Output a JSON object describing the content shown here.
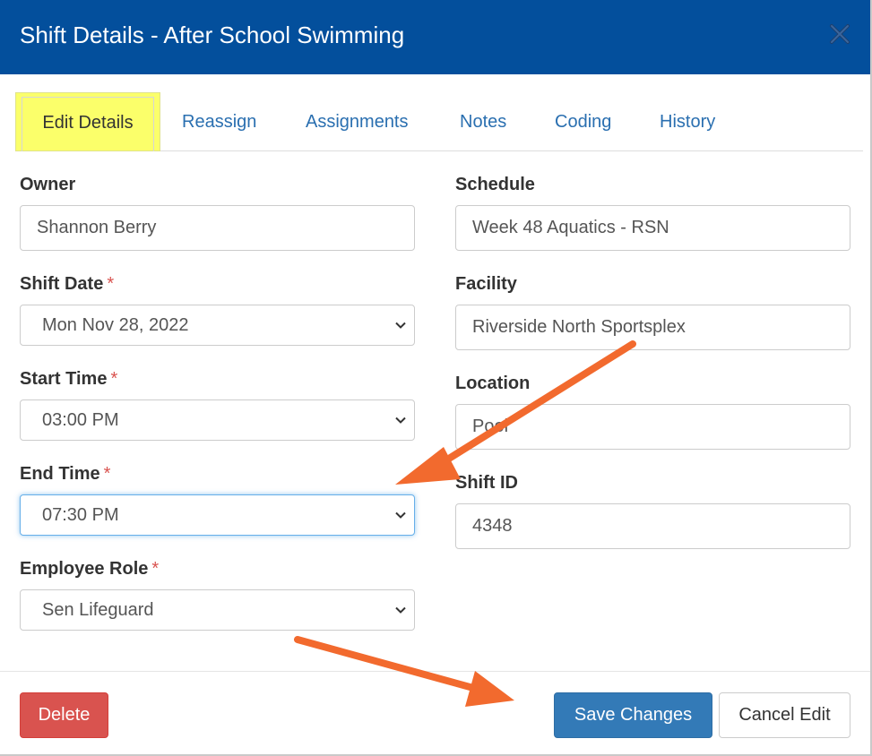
{
  "header": {
    "title": "Shift Details - After School Swimming",
    "close_icon": "close-icon",
    "background": "#034f9c"
  },
  "tabs": [
    {
      "label": "Edit Details",
      "active": true
    },
    {
      "label": "Reassign",
      "active": false
    },
    {
      "label": "Assignments",
      "active": false
    },
    {
      "label": "Notes",
      "active": false
    },
    {
      "label": "Coding",
      "active": false
    },
    {
      "label": "History",
      "active": false
    }
  ],
  "form": {
    "owner": {
      "label": "Owner",
      "value": "Shannon Berry"
    },
    "shift_date": {
      "label": "Shift Date",
      "required": "*",
      "value": "Mon Nov 28, 2022"
    },
    "start_time": {
      "label": "Start Time",
      "required": "*",
      "value": "03:00 PM"
    },
    "end_time": {
      "label": "End Time",
      "required": "*",
      "value": "07:30 PM"
    },
    "employee_role": {
      "label": "Employee Role",
      "required": "*",
      "value": "Sen Lifeguard"
    },
    "schedule": {
      "label": "Schedule",
      "value": "Week 48 Aquatics - RSN"
    },
    "facility": {
      "label": "Facility",
      "value": "Riverside North Sportsplex"
    },
    "location": {
      "label": "Location",
      "value": "Pool"
    },
    "shift_id": {
      "label": "Shift ID",
      "value": "4348"
    }
  },
  "footer": {
    "delete_label": "Delete",
    "save_label": "Save Changes",
    "cancel_label": "Cancel Edit"
  },
  "annotations": {
    "highlight_color": "#fbff6a",
    "arrow_color": "#f26a2e"
  }
}
